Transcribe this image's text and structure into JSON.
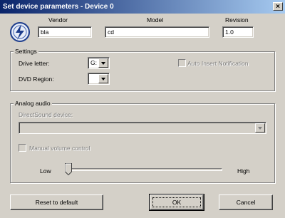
{
  "window": {
    "title": "Set device parameters - Device 0",
    "close_label": "×"
  },
  "header": {
    "vendor_label": "Vendor",
    "vendor_value": "bla",
    "model_label": "Model",
    "model_value": "cd",
    "revision_label": "Revision",
    "revision_value": "1.0",
    "icon": "lightning-disc-icon"
  },
  "settings": {
    "group_label": "Settings",
    "drive_letter_label": "Drive letter:",
    "drive_letter_value": "G:",
    "dvd_region_label": "DVD Region:",
    "dvd_region_value": "",
    "auto_insert_label": "Auto Insert Notification",
    "auto_insert_checked": false
  },
  "analog_audio": {
    "group_label": "Analog audio",
    "directsound_label": "DirectSound device:",
    "directsound_value": "",
    "manual_volume_label": "Manual volume control",
    "manual_volume_checked": false,
    "slider_low_label": "Low",
    "slider_high_label": "High",
    "slider_value": 0
  },
  "buttons": {
    "reset_label": "Reset to default",
    "ok_label": "OK",
    "cancel_label": "Cancel"
  },
  "colors": {
    "title_start": "#0a246a",
    "title_end": "#a6caf0",
    "face": "#d4d0c8"
  }
}
